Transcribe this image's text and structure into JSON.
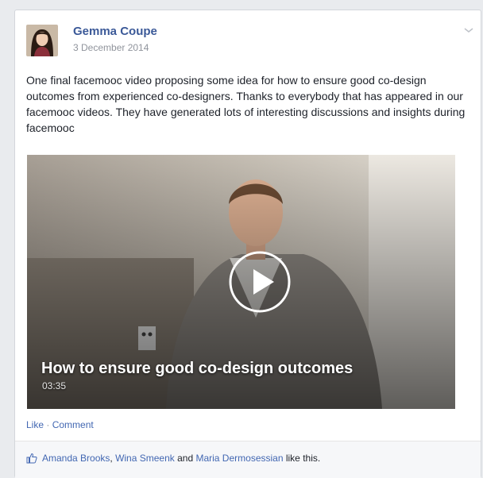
{
  "post": {
    "author": "Gemma Coupe",
    "date": "3 December 2014",
    "text": "One final facemooc video proposing some idea for how to ensure good co-design outcomes from experienced co-designers. Thanks to everybody that has appeared in our facemooc videos. They have generated lots of interesting discussions and insights during facemooc",
    "avatar_icon": "profile-photo",
    "menu_icon": "chevron-down-icon"
  },
  "video": {
    "title": "How to ensure good co-design outcomes",
    "duration": "03:35",
    "play_icon": "play-icon"
  },
  "actions": {
    "like": "Like",
    "separator": "·",
    "comment": "Comment"
  },
  "likes": {
    "icon": "thumbs-up-icon",
    "name1": "Amanda Brooks",
    "sep1": ", ",
    "name2": "Wina Smeenk",
    "and": " and ",
    "name3": "Maria Dermosessian",
    "suffix": " like this."
  },
  "colors": {
    "link": "#3b5998",
    "text": "#1d2129",
    "muted": "#90949c"
  }
}
